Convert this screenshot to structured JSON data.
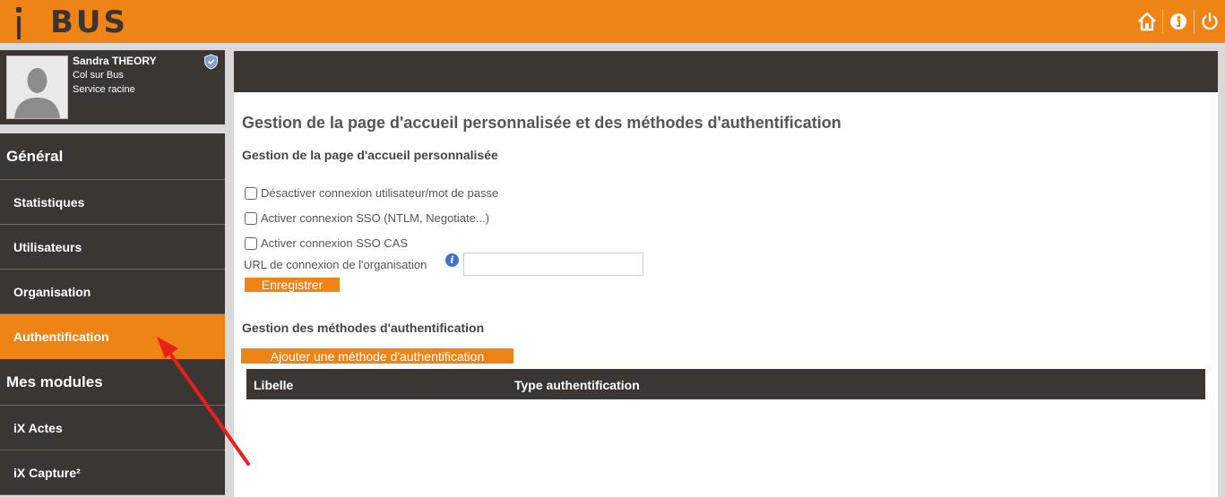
{
  "header": {
    "logo_text": "BUS",
    "actions": [
      {
        "name": "home-icon"
      },
      {
        "name": "info-icon"
      },
      {
        "name": "power-icon"
      }
    ]
  },
  "profile": {
    "name": "Sandra THEORY",
    "line1": "Col sur Bus",
    "line2": "Service racine"
  },
  "nav": {
    "section_general": "Général",
    "items": [
      {
        "label": "Statistiques"
      },
      {
        "label": "Utilisateurs"
      },
      {
        "label": "Organisation"
      },
      {
        "label": "Authentification"
      }
    ],
    "section_modules": "Mes modules",
    "modules": [
      {
        "label": "iX Actes"
      },
      {
        "label": "iX Capture²"
      }
    ]
  },
  "main": {
    "title": "Gestion de la page d'accueil personnalisée et des méthodes d'authentification",
    "section1_title": "Gestion de la page d'accueil personnalisée",
    "checkboxes": [
      {
        "label": "Désactiver connexion utilisateur/mot de passe",
        "checked": false
      },
      {
        "label": "Activer connexion SSO (NTLM, Negotiate...)",
        "checked": false
      },
      {
        "label": "Activer connexion SSO CAS",
        "checked": false
      }
    ],
    "url_label": "URL de connexion de l'organisation",
    "url_value": "",
    "save_button": "Enregistrer",
    "section2_title": "Gestion des méthodes d'authentification",
    "add_button": "Ajouter une méthode d'authentification",
    "table_headers": [
      "Libelle",
      "Type authentification"
    ]
  },
  "colors": {
    "accent": "#ee8416",
    "dark": "#3b3632",
    "annotation_arrow": "#e8201b"
  }
}
